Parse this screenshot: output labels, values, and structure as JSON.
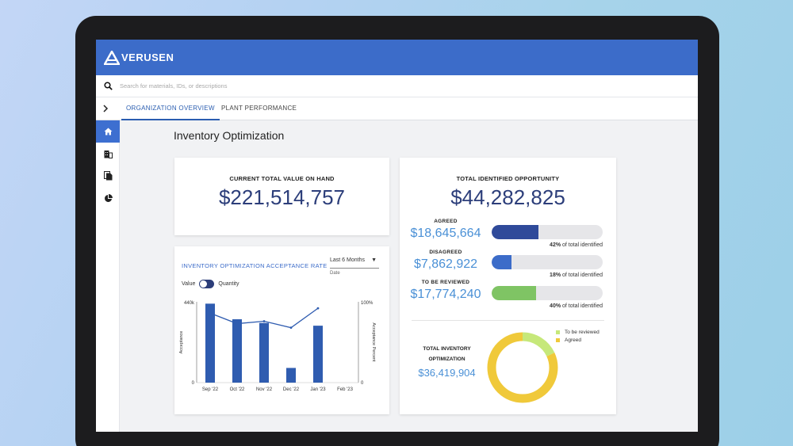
{
  "app": {
    "brand": "VERUSEN"
  },
  "search": {
    "placeholder": "Search for materials, IDs, or descriptions"
  },
  "tabs": [
    {
      "label": "ORGANIZATION OVERVIEW",
      "active": true
    },
    {
      "label": "PLANT PERFORMANCE",
      "active": false
    }
  ],
  "sidebar": {
    "items": [
      {
        "icon": "home-icon",
        "active": true
      },
      {
        "icon": "building-icon",
        "active": false
      },
      {
        "icon": "documents-icon",
        "active": false
      },
      {
        "icon": "pie-chart-icon",
        "active": false
      }
    ]
  },
  "page": {
    "title": "Inventory Optimization"
  },
  "value_on_hand": {
    "label": "CURRENT TOTAL VALUE ON HAND",
    "value": "$221,514,757"
  },
  "acceptance": {
    "title": "INVENTORY OPTIMIZATION ACCEPTANCE RATE",
    "dropdown_value": "Last 6 Months",
    "dropdown_label": "Date",
    "toggle_left": "Value",
    "toggle_right": "Quantity"
  },
  "opportunity": {
    "label": "TOTAL IDENTIFIED OPPORTUNITY",
    "value": "$44,282,825",
    "rows": [
      {
        "label": "AGREED",
        "value": "$18,645,664",
        "percent": 42,
        "percent_text": "42%",
        "caption": " of total identified",
        "color": "#2f4a9a"
      },
      {
        "label": "DISAGREED",
        "value": "$7,862,922",
        "percent": 18,
        "percent_text": "18%",
        "caption": " of total identified",
        "color": "#3c6cc9"
      },
      {
        "label": "TO BE REVIEWED",
        "value": "$17,774,240",
        "percent": 40,
        "percent_text": "40%",
        "caption": " of total identified",
        "color": "#7fc464"
      }
    ],
    "total_label": "TOTAL INVENTORY OPTIMIZATION",
    "total_value": "$36,419,904"
  },
  "colors": {
    "primary": "#3c6cc9",
    "navy": "#2c3e7a",
    "light_blue": "#4a90d6",
    "green": "#7fc464"
  },
  "chart_data": [
    {
      "type": "bar",
      "title": "INVENTORY OPTIMIZATION ACCEPTANCE RATE",
      "categories": [
        "Sep '22",
        "Oct '22",
        "Nov '22",
        "Dec '22",
        "Jan '23",
        "Feb '23"
      ],
      "ylabel": "Acceptance",
      "y2label": "Acceptance Percent",
      "ylim": [
        0,
        440000
      ],
      "y_ticks": [
        "440k",
        "0"
      ],
      "y2lim": [
        0,
        100
      ],
      "y2_ticks": [
        "100%",
        "0"
      ],
      "series": [
        {
          "type": "bar",
          "values": [
            430000,
            345000,
            325000,
            80000,
            310000,
            null
          ]
        },
        {
          "type": "line",
          "axis": "right",
          "values": [
            86,
            73,
            76,
            68,
            92,
            null
          ]
        }
      ],
      "grid": false
    },
    {
      "type": "pie",
      "title": "TOTAL INVENTORY OPTIMIZATION",
      "slices": [
        {
          "label": "To be reviewed",
          "value": 18,
          "color": "#c6e87a"
        },
        {
          "label": "Agreed",
          "value": 82,
          "color": "#f0c93a"
        }
      ],
      "legend": "top-right"
    }
  ]
}
